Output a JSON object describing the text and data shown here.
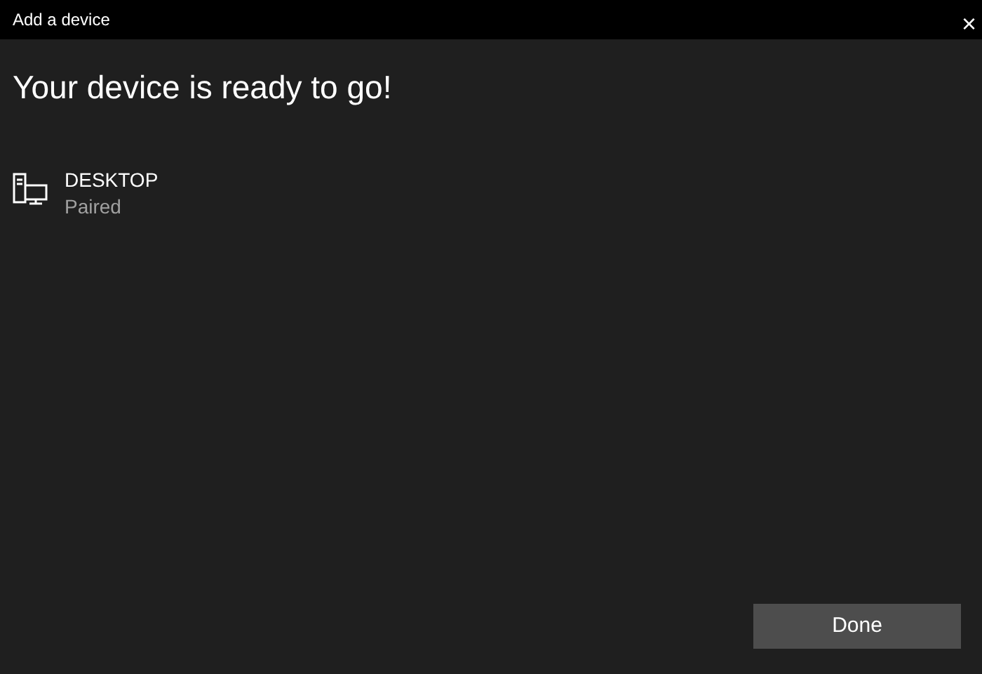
{
  "window": {
    "title": "Add a device",
    "close": "×"
  },
  "heading": "Your device is ready to go!",
  "devices": [
    {
      "name": "DESKTOP",
      "status": "Paired"
    }
  ],
  "buttons": [
    "Done"
  ]
}
